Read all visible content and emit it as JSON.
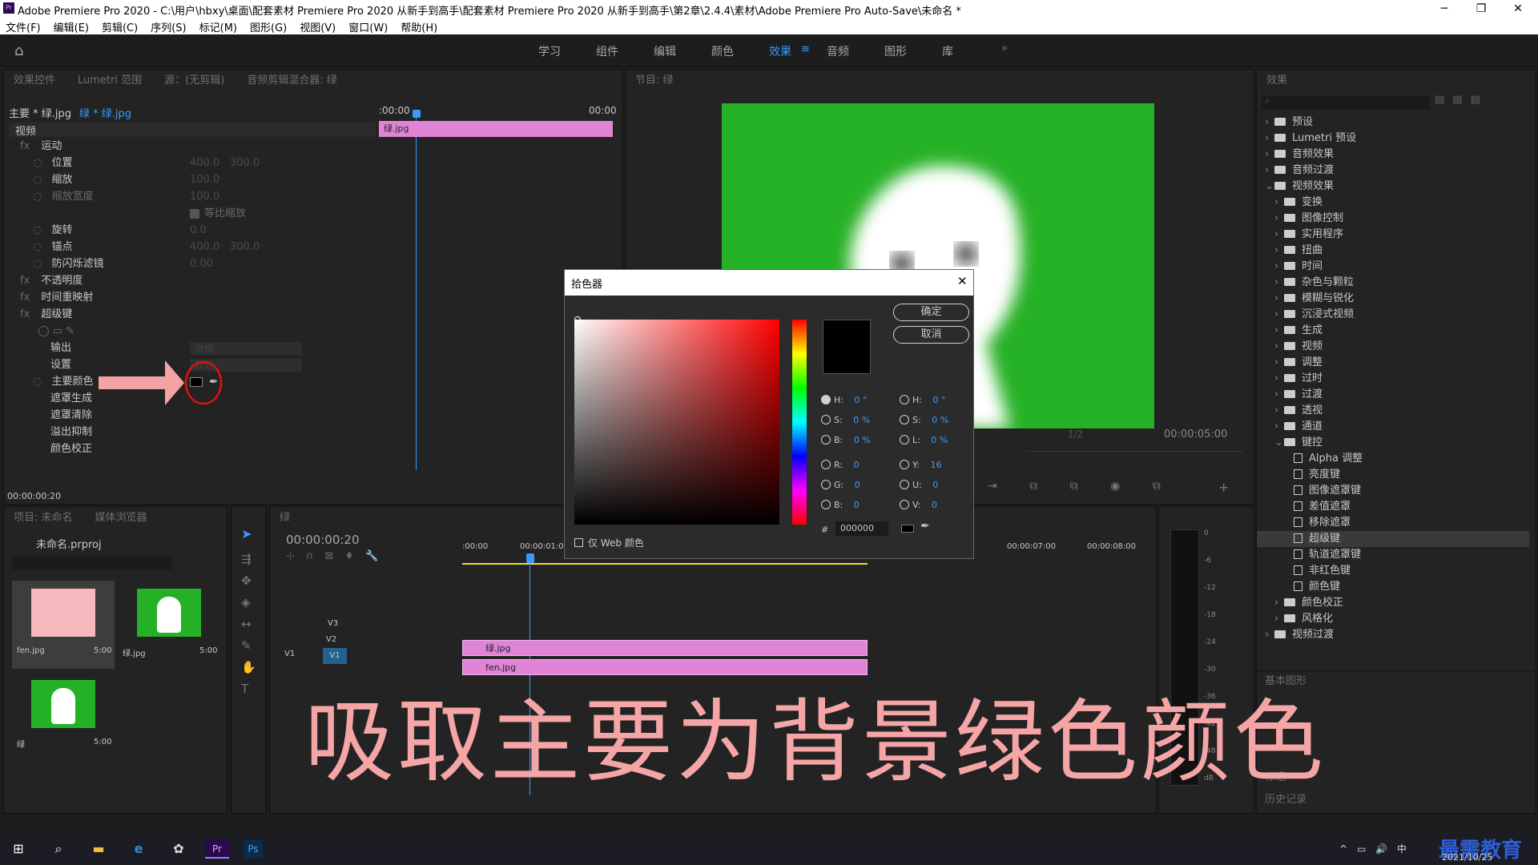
{
  "window": {
    "title": "Adobe Premiere Pro 2020 - C:\\用户\\hbxy\\桌面\\配套素材 Premiere Pro 2020 从新手到高手\\配套素材 Premiere Pro 2020 从新手到高手\\第2章\\2.4.4\\素材\\Adobe Premiere Pro Auto-Save\\未命名 *",
    "logo": "Pr"
  },
  "menu": [
    "文件(F)",
    "编辑(E)",
    "剪辑(C)",
    "序列(S)",
    "标记(M)",
    "图形(G)",
    "视图(V)",
    "窗口(W)",
    "帮助(H)"
  ],
  "workspaces": [
    "学习",
    "组件",
    "编辑",
    "颜色",
    "效果",
    "音频",
    "图形",
    "库"
  ],
  "active_workspace": "效果",
  "effect_controls": {
    "tabs": [
      "效果控件",
      "Lumetri 范围",
      "源：(无剪辑)",
      "音频剪辑混合器: 绿"
    ],
    "source": "主要 * 绿.jpg",
    "clip": "绿 * 绿.jpg",
    "tl_start": ":00:00",
    "tl_end": "00:00",
    "clip_label": "绿.jpg",
    "video_label": "视频",
    "rows": [
      {
        "label": "运动",
        "type": "fx"
      },
      {
        "label": "位置",
        "v1": "400.0",
        "v2": "300.0"
      },
      {
        "label": "缩放",
        "v1": "100.0"
      },
      {
        "label": "缩放宽度",
        "v1": "100.0"
      },
      {
        "label": "等比缩放",
        "type": "check"
      },
      {
        "label": "旋转",
        "v1": "0.0"
      },
      {
        "label": "锚点",
        "v1": "400.0",
        "v2": "300.0"
      },
      {
        "label": "防闪烁滤镜",
        "v1": "0.00"
      },
      {
        "label": "不透明度",
        "type": "fx"
      },
      {
        "label": "时间重映射",
        "type": "fx"
      },
      {
        "label": "超级键",
        "type": "fx"
      },
      {
        "label": "",
        "type": "masks"
      },
      {
        "label": "输出",
        "v1": "合成"
      },
      {
        "label": "设置",
        "v1": "默认"
      },
      {
        "label": "主要颜色",
        "type": "color"
      },
      {
        "label": "遮罩生成"
      },
      {
        "label": "遮罩清除"
      },
      {
        "label": "溢出抑制"
      },
      {
        "label": "颜色校正"
      }
    ],
    "timecode": "00:00:00:20"
  },
  "program": {
    "tab": "节目: 绿",
    "timecode": "00:00:05:00",
    "zoom": "1/2"
  },
  "color_picker": {
    "title": "拾色器",
    "ok": "确定",
    "cancel": "取消",
    "hsb": [
      {
        "k": "H:",
        "v": "0 °"
      },
      {
        "k": "S:",
        "v": "0 %"
      },
      {
        "k": "B:",
        "v": "0 %"
      }
    ],
    "hsl": [
      {
        "k": "H:",
        "v": "0 °"
      },
      {
        "k": "S:",
        "v": "0 %"
      },
      {
        "k": "L:",
        "v": "0 %"
      }
    ],
    "rgb": [
      {
        "k": "R:",
        "v": "0"
      },
      {
        "k": "G:",
        "v": "0"
      },
      {
        "k": "B:",
        "v": "0"
      }
    ],
    "yuv": [
      {
        "k": "Y:",
        "v": "16"
      },
      {
        "k": "U:",
        "v": "0"
      },
      {
        "k": "V:",
        "v": "0"
      }
    ],
    "hash": "#",
    "hex": "000000",
    "web_only": "仅 Web 颜色"
  },
  "effects": {
    "tab": "效果",
    "tree": [
      {
        "label": "预设",
        "level": 0,
        "open": false
      },
      {
        "label": "Lumetri 预设",
        "level": 0,
        "open": false
      },
      {
        "label": "音频效果",
        "level": 0,
        "open": false
      },
      {
        "label": "音频过渡",
        "level": 0,
        "open": false
      },
      {
        "label": "视频效果",
        "level": 0,
        "open": true
      },
      {
        "label": "变换",
        "level": 1
      },
      {
        "label": "图像控制",
        "level": 1
      },
      {
        "label": "实用程序",
        "level": 1
      },
      {
        "label": "扭曲",
        "level": 1
      },
      {
        "label": "时间",
        "level": 1
      },
      {
        "label": "杂色与颗粒",
        "level": 1
      },
      {
        "label": "模糊与锐化",
        "level": 1
      },
      {
        "label": "沉浸式视频",
        "level": 1
      },
      {
        "label": "生成",
        "level": 1
      },
      {
        "label": "视频",
        "level": 1
      },
      {
        "label": "调整",
        "level": 1
      },
      {
        "label": "过时",
        "level": 1
      },
      {
        "label": "过渡",
        "level": 1
      },
      {
        "label": "透视",
        "level": 1
      },
      {
        "label": "通道",
        "level": 1
      },
      {
        "label": "键控",
        "level": 1,
        "open": true
      },
      {
        "label": "Alpha 调整",
        "level": 2
      },
      {
        "label": "亮度键",
        "level": 2
      },
      {
        "label": "图像遮罩键",
        "level": 2
      },
      {
        "label": "差值遮罩",
        "level": 2
      },
      {
        "label": "移除遮罩",
        "level": 2
      },
      {
        "label": "超级键",
        "level": 2,
        "selected": true
      },
      {
        "label": "轨道遮罩键",
        "level": 2
      },
      {
        "label": "非红色键",
        "level": 2
      },
      {
        "label": "颜色键",
        "level": 2
      },
      {
        "label": "颜色校正",
        "level": 1
      },
      {
        "label": "风格化",
        "level": 1
      },
      {
        "label": "视频过渡",
        "level": 0,
        "open": false
      }
    ],
    "lower": [
      "基本图形",
      "标记",
      "历史记录"
    ]
  },
  "project": {
    "tabs": [
      "项目: 未命名",
      "媒体浏览器"
    ],
    "file": "未命名.prproj",
    "items": [
      {
        "name": "fen.jpg",
        "dur": "5:00"
      },
      {
        "name": "绿.jpg",
        "dur": "5:00"
      },
      {
        "name": "绿",
        "dur": "5:00"
      }
    ]
  },
  "timeline": {
    "tab": "绿",
    "timecode": "00:00:00:20",
    "ticks": [
      ":00:00",
      "00:00:01:00",
      "00:00:07:00",
      "00:00:08:00"
    ],
    "tracks": [
      "V3",
      "V2",
      "V1"
    ],
    "source_track": "V1",
    "clips": [
      {
        "name": "绿.jpg",
        "track": "V2"
      },
      {
        "name": "fen.jpg",
        "track": "V1"
      }
    ]
  },
  "meter": [
    "0",
    "-6",
    "-12",
    "-18",
    "-24",
    "-30",
    "-36",
    "-42",
    "-48",
    "dB"
  ],
  "caption": "吸取主要为背景绿色颜色",
  "watermark": {
    "brand": "最需教育",
    "date": "2021/10/25"
  },
  "colors": {
    "accent": "#3a9bfc",
    "clip": "#e084d8",
    "green": "#25b125",
    "caption": "#f5a5a6",
    "arrow": "#f3a3a4",
    "circle": "#e01010"
  }
}
